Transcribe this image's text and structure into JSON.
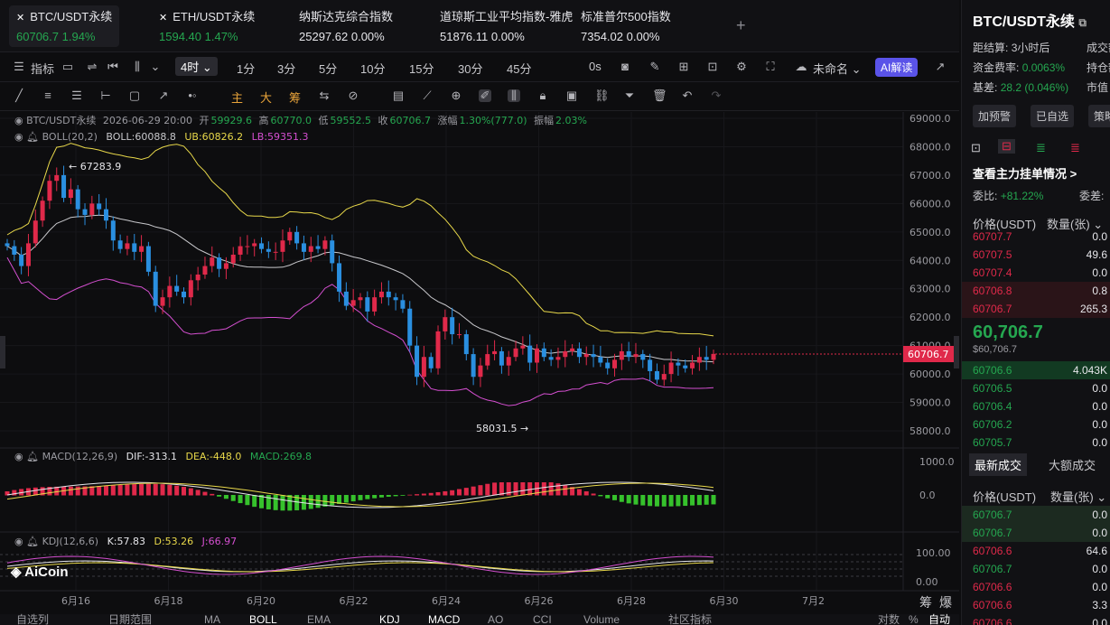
{
  "tickers": [
    {
      "name": "BTC/USDT永续",
      "price": "60706.7",
      "change": "1.94%",
      "dir": "up",
      "active": true
    },
    {
      "name": "ETH/USDT永续",
      "price": "1594.40",
      "change": "1.47%",
      "dir": "up",
      "active": false
    },
    {
      "name": "纳斯达克综合指数",
      "price": "25297.62",
      "change": "0.00%",
      "dir": "neu",
      "active": false
    },
    {
      "name": "道琼斯工业平均指数-雅虎",
      "price": "51876.11",
      "change": "0.00%",
      "dir": "neu",
      "active": false
    },
    {
      "name": "标准普尔500指数",
      "price": "7354.02",
      "change": "0.00%",
      "dir": "neu",
      "active": false
    }
  ],
  "add_tab": "+",
  "toolbar": {
    "indicators": "指标",
    "period_selected": "4时",
    "periods": [
      "1分",
      "3分",
      "5分",
      "10分",
      "15分",
      "30分",
      "45分"
    ],
    "zero_s": "0s",
    "layout_name": "未命名",
    "ai_label": "AI解读"
  },
  "draw_tools": {
    "main": "主",
    "big": "大",
    "chip": "筹"
  },
  "info_line": {
    "symbol": "BTC/USDT永续",
    "datetime": "2026-06-29 20:00",
    "open_label": "开",
    "open": "59929.6",
    "high_label": "高",
    "high": "60770.0",
    "low_label": "低",
    "low": "59552.5",
    "close_label": "收",
    "close": "60706.7",
    "change_label": "涨幅",
    "change": "1.30%(777.0)",
    "amp_label": "振幅",
    "amp": "2.03%"
  },
  "boll": {
    "title": "BOLL(20,2)",
    "mid": "BOLL:60088.8",
    "ub": "UB:60826.2",
    "lb": "LB:59351.3"
  },
  "macd": {
    "title": "MACD(12,26,9)",
    "dif": "DIF:-313.1",
    "dea": "DEA:-448.0",
    "macd": "MACD:269.8"
  },
  "kdj": {
    "title": "KDJ(12,6,6)",
    "k": "K:57.83",
    "d": "D:53.26",
    "j": "J:66.97"
  },
  "price_axis": [
    "69000.0",
    "68000.0",
    "67000.0",
    "66000.0",
    "65000.0",
    "64000.0",
    "63000.0",
    "62000.0",
    "61000.0",
    "60000.0",
    "59000.0",
    "58000.0"
  ],
  "current_price_tag": "60706.7",
  "macd_axis": [
    "1000.0",
    "0.0"
  ],
  "kdj_axis": [
    "100.00",
    "0.00"
  ],
  "x_axis": [
    "6月16",
    "6月18",
    "6月20",
    "6月22",
    "6月24",
    "6月26",
    "6月28",
    "6月30",
    "7月2"
  ],
  "high_mark": "67283.9",
  "low_mark": "58031.5 →",
  "logo": "AiCoin",
  "bottom_tabs": [
    "自选列",
    "日期范围",
    "MA",
    "BOLL",
    "EMA",
    "KDJ",
    "MACD",
    "AO",
    "CCI",
    "Volume",
    "社区指标",
    "对数",
    "%",
    "自动"
  ],
  "corner_right": {
    "chip": "筹",
    "burst": "爆"
  },
  "colors": {
    "up": "#25a750",
    "down": "#e0294a",
    "boll_ub": "#e8d84a",
    "boll_lb": "#d44fd0",
    "boll_mid": "#c8c8cc",
    "accent": "#5a53e8"
  },
  "chart_data": {
    "type": "candlestick",
    "interval": "4h",
    "x_range": [
      "6月15",
      "6月30"
    ],
    "ylim": [
      58000,
      69000
    ],
    "high_label": 67283.9,
    "low_label": 58031.5,
    "last_close": 60706.7,
    "boll": {
      "mid": 60088.8,
      "ub": 60826.2,
      "lb": 59351.3
    },
    "macd": {
      "dif": -313.1,
      "dea": -448.0,
      "macd": 269.8
    },
    "kdj": {
      "k": 57.83,
      "d": 53.26,
      "j": 66.97
    }
  },
  "right_panel": {
    "symbol": "BTC/USDT永续",
    "settle_label": "距结算:",
    "settle": "3小时后",
    "volume_label": "成交额",
    "funding_label": "资金费率:",
    "funding": "0.0063%",
    "oi_label": "持仓额",
    "basis_label": "基差:",
    "basis": "28.2 (0.046%)",
    "mcap_label": "市值",
    "buttons": [
      "加预警",
      "已自选",
      "策略"
    ],
    "depth_link": "查看主力挂单情况 >",
    "ratio_label": "委比:",
    "ratio": "+81.22%",
    "diff_label": "委差:",
    "col_price": "价格(USDT)",
    "col_qty": "数量(张)",
    "asks": [
      {
        "p": "60707.7",
        "q": "0.0"
      },
      {
        "p": "60707.5",
        "q": "49.6"
      },
      {
        "p": "60707.4",
        "q": "0.0"
      },
      {
        "p": "60706.8",
        "q": "0.8"
      },
      {
        "p": "60706.7",
        "q": "265.3"
      }
    ],
    "last_price": "60,706.7",
    "last_price_sub": "$60,706.7",
    "bids": [
      {
        "p": "60706.6",
        "q": "4.043K"
      },
      {
        "p": "60706.5",
        "q": "0.0"
      },
      {
        "p": "60706.4",
        "q": "0.0"
      },
      {
        "p": "60706.2",
        "q": "0.0"
      },
      {
        "p": "60705.7",
        "q": "0.0"
      }
    ],
    "trade_tabs": [
      "最新成交",
      "大额成交"
    ],
    "trades": [
      {
        "p": "60706.7",
        "q": "0.0",
        "dir": "up"
      },
      {
        "p": "60706.7",
        "q": "0.0",
        "dir": "up"
      },
      {
        "p": "60706.6",
        "q": "64.6",
        "dir": "dn"
      },
      {
        "p": "60706.7",
        "q": "0.0",
        "dir": "up"
      },
      {
        "p": "60706.6",
        "q": "0.0",
        "dir": "dn"
      },
      {
        "p": "60706.6",
        "q": "3.3",
        "dir": "dn"
      },
      {
        "p": "60706.6",
        "q": "0.0",
        "dir": "dn"
      }
    ]
  }
}
